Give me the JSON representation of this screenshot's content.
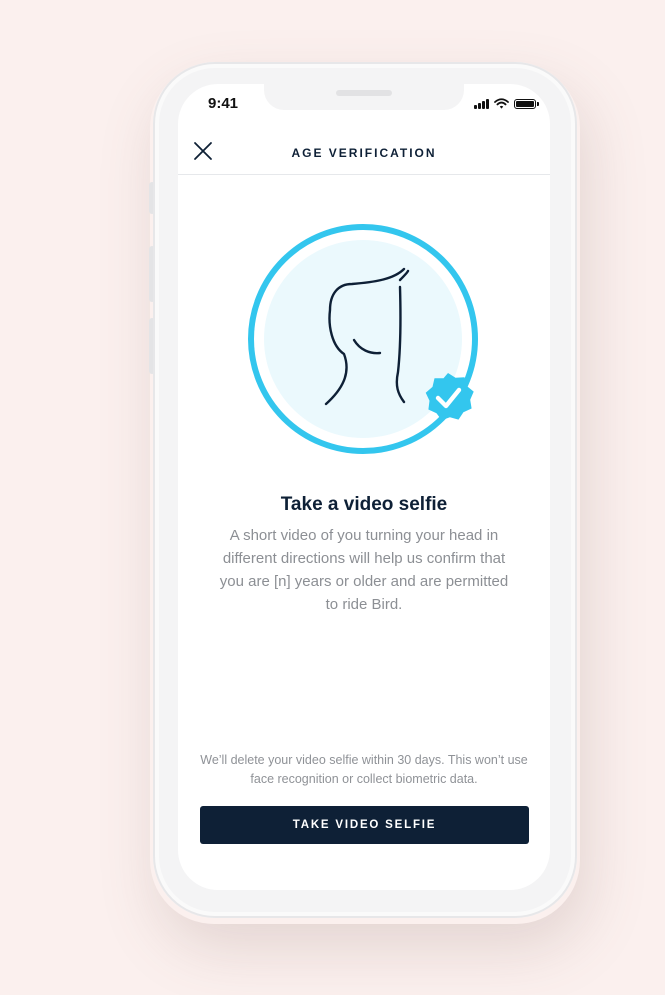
{
  "status_bar": {
    "time": "9:41"
  },
  "header": {
    "title": "AGE VERIFICATION"
  },
  "content": {
    "title": "Take a video selfie",
    "description": "A short video of you turning your head in different directions will help us confirm that you are [n] years or older and are permitted to ride Bird.",
    "privacy_note": "We’ll delete your video selfie within 30 days. This won’t use face recognition or collect biometric data."
  },
  "actions": {
    "primary_label": "TAKE VIDEO SELFIE"
  },
  "colors": {
    "accent": "#33c6ee",
    "navy": "#0e2036",
    "background": "#fbf0ee"
  },
  "icons": [
    "close-icon",
    "face-profile-icon",
    "verified-badge-icon",
    "signal-icon",
    "wifi-icon",
    "battery-icon"
  ]
}
